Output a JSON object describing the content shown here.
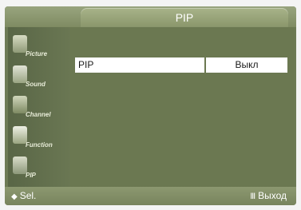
{
  "title": "PIP",
  "sidebar": {
    "items": [
      {
        "label": "Picture",
        "icon": "picture-icon"
      },
      {
        "label": "Sound",
        "icon": "sound-icon"
      },
      {
        "label": "Channel",
        "icon": "channel-icon"
      },
      {
        "label": "Function",
        "icon": "function-icon"
      },
      {
        "label": "PIP",
        "icon": "pip-icon"
      }
    ]
  },
  "menu": {
    "rows": [
      {
        "label": "PIP",
        "value": "Выкл"
      }
    ]
  },
  "footer": {
    "select_glyph": "◆",
    "select_label": "Sel.",
    "exit_glyph": "Ⅲ",
    "exit_label": "Выход"
  }
}
